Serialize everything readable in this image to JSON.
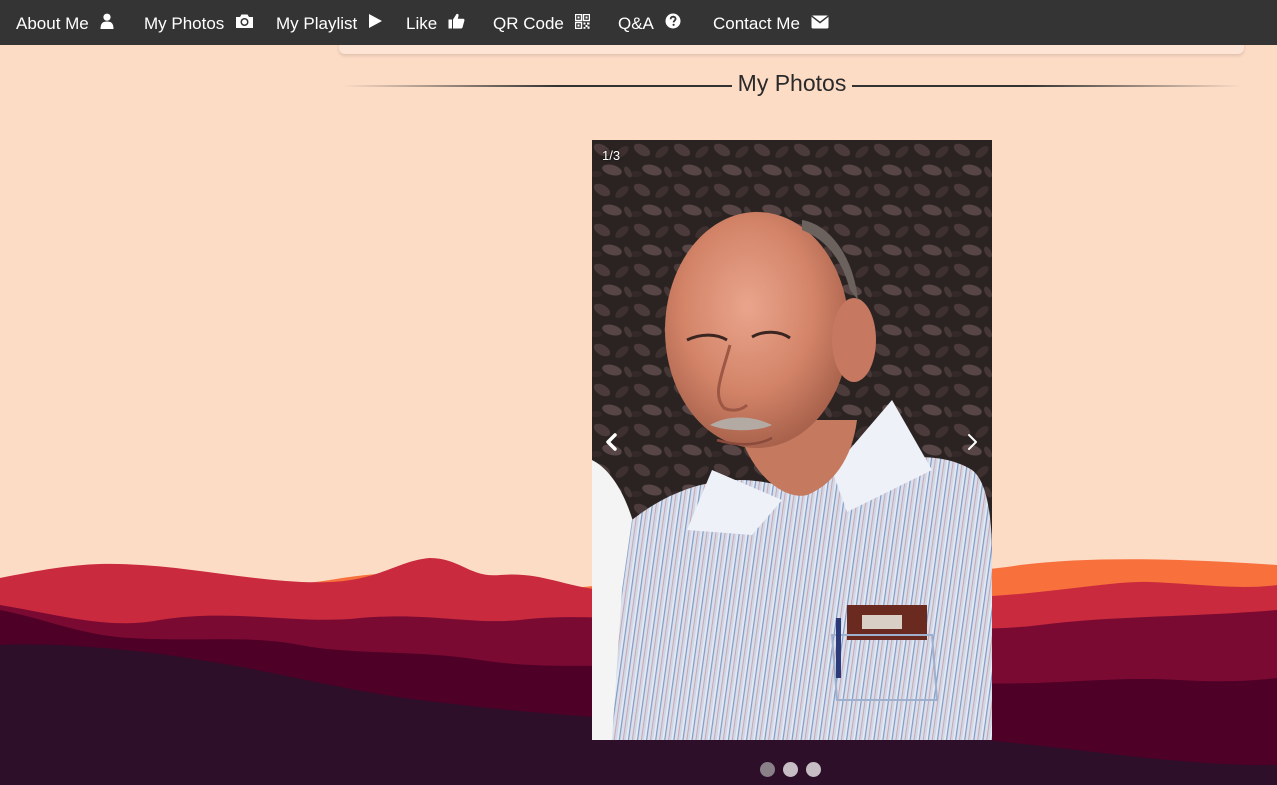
{
  "nav": {
    "items": [
      {
        "label": "About Me",
        "icon": "user-icon"
      },
      {
        "label": "My Photos",
        "icon": "camera-icon"
      },
      {
        "label": "My Playlist",
        "icon": "play-icon"
      },
      {
        "label": "Like",
        "icon": "thumbs-up-icon"
      },
      {
        "label": "QR Code",
        "icon": "qr-code-icon"
      },
      {
        "label": "Q&A",
        "icon": "question-circle-icon"
      },
      {
        "label": "Contact Me",
        "icon": "envelope-icon"
      }
    ]
  },
  "section": {
    "title": "My Photos"
  },
  "carousel": {
    "counter": "1/3",
    "current": 1,
    "total": 3,
    "prev_icon": "chevron-left-icon",
    "next_icon": "chevron-right-icon"
  },
  "colors": {
    "navbar_bg": "#343434",
    "page_bg": "#fddcc6",
    "mountain_orange": "#f8703c",
    "mountain_red": "#c92a3e",
    "mountain_maroon": "#7b0a32",
    "mountain_dark": "#4e0027",
    "mountain_darkest": "#2d0f2a",
    "dot_active": "#8a8088",
    "dot_inactive": "#c6bec4"
  }
}
